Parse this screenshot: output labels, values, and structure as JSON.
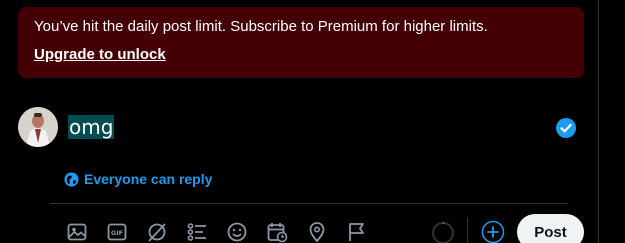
{
  "banner": {
    "message": "You’ve hit the daily post limit. Subscribe to Premium for higher limits.",
    "link_label": "Upgrade to unlock"
  },
  "composer": {
    "text": "omg"
  },
  "reply_setting": {
    "label": "Everyone can reply",
    "icon": "globe-icon"
  },
  "toolbar": {
    "icons": [
      "media-icon",
      "gif-icon",
      "grok-icon",
      "poll-icon",
      "emoji-icon",
      "schedule-icon",
      "location-icon",
      "flag-icon"
    ],
    "gif_label": "GIF",
    "post_label": "Post"
  },
  "colors": {
    "accent": "#1d9bf0",
    "banner_bg": "#450006",
    "selection": "#004d52",
    "icon": "#8b98a5"
  }
}
